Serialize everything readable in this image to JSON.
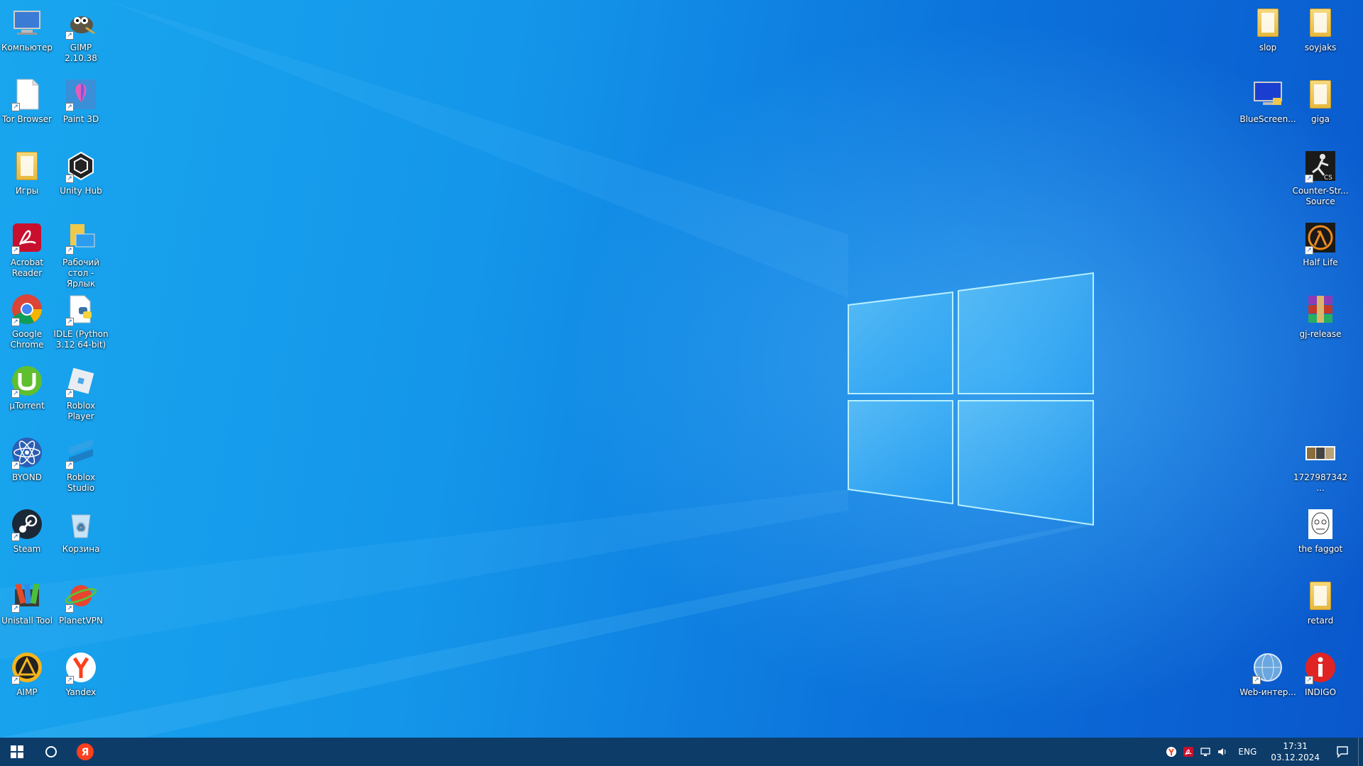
{
  "desktop": {
    "left_col1": [
      {
        "label": "Компьютер",
        "icon": "computer-icon"
      },
      {
        "label": "Tor Browser",
        "icon": "file-icon"
      },
      {
        "label": "Игры",
        "icon": "folder-icon"
      },
      {
        "label": "Acrobat Reader",
        "icon": "acrobat-icon"
      },
      {
        "label": "Google Chrome",
        "icon": "chrome-icon"
      },
      {
        "label": "µTorrent",
        "icon": "utorrent-icon"
      },
      {
        "label": "BYOND",
        "icon": "byond-icon"
      },
      {
        "label": "Steam",
        "icon": "steam-icon"
      },
      {
        "label": "Unistall Tool",
        "icon": "uninstall-tool-icon"
      },
      {
        "label": "AIMP",
        "icon": "aimp-icon"
      }
    ],
    "left_col2": [
      {
        "label": "GIMP 2.10.38",
        "icon": "gimp-icon"
      },
      {
        "label": "Paint 3D",
        "icon": "paint3d-icon"
      },
      {
        "label": "Unity Hub",
        "icon": "unity-icon"
      },
      {
        "label": "Рабочий стол - Ярлык",
        "icon": "desktop-shortcut-icon"
      },
      {
        "label": "IDLE (Python 3.12 64-bit)",
        "icon": "python-icon"
      },
      {
        "label": "Roblox Player",
        "icon": "roblox-icon"
      },
      {
        "label": "Roblox Studio",
        "icon": "roblox-studio-icon"
      },
      {
        "label": "Корзина",
        "icon": "recycle-bin-icon"
      },
      {
        "label": "PlanetVPN",
        "icon": "planetvpn-icon"
      },
      {
        "label": "Yandex",
        "icon": "yandex-icon"
      }
    ],
    "right_col1": [
      {
        "label": "slop",
        "icon": "folder-icon"
      },
      {
        "label": "BlueScreen...",
        "icon": "bluescreen-icon"
      },
      {
        "label": "Web-интер...",
        "icon": "globe-icon"
      }
    ],
    "right_col2": [
      {
        "label": "soyjaks",
        "icon": "folder-icon"
      },
      {
        "label": "giga",
        "icon": "folder-icon"
      },
      {
        "label": "Counter-Str... Source",
        "icon": "counter-strike-icon"
      },
      {
        "label": "Half Life",
        "icon": "half-life-icon"
      },
      {
        "label": "gj-release",
        "icon": "winrar-icon"
      },
      {
        "label": "1727987342...",
        "icon": "image-icon"
      },
      {
        "label": "the faggot",
        "icon": "image-icon"
      },
      {
        "label": "retard",
        "icon": "folder-icon"
      },
      {
        "label": "INDIGO",
        "icon": "indigo-icon"
      }
    ]
  },
  "taskbar": {
    "start": "windows-start-icon",
    "search": "cortana-icon",
    "pinned": [
      {
        "name": "Яндекс",
        "icon": "yandex-browser-icon",
        "glyph": "Я"
      }
    ],
    "tray": {
      "icons": [
        "yandex-tray-icon",
        "acrobat-tray-icon",
        "network-icon",
        "volume-icon"
      ],
      "language": "ENG",
      "time": "17:31",
      "date": "03.12.2024"
    }
  },
  "colors": {
    "accent": "#1496ea",
    "taskbar": "#0e3760"
  }
}
